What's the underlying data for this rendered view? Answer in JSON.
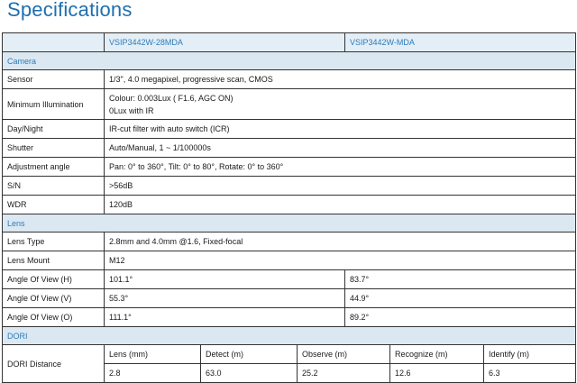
{
  "title": "Specifications",
  "models": [
    "VSIP3442W-28MDA",
    "VSIP3442W-MDA"
  ],
  "sections": {
    "camera": "Camera",
    "lens": "Lens",
    "dori": "DORI"
  },
  "camera": {
    "sensor": {
      "label": "Sensor",
      "value": "1/3\", 4.0 megapixel, progressive scan, CMOS"
    },
    "min_illum": {
      "label": "Minimum Illumination",
      "line1": "Colour: 0.003Lux ( F1.6, AGC ON)",
      "line2": "0Lux with IR"
    },
    "daynight": {
      "label": "Day/Night",
      "value": "IR-cut filter with auto switch (ICR)"
    },
    "shutter": {
      "label": "Shutter",
      "value": "Auto/Manual, 1 ~ 1/100000s"
    },
    "adjust": {
      "label": "Adjustment angle",
      "value": "Pan: 0° to 360°, Tilt: 0° to 80°, Rotate: 0° to 360°"
    },
    "sn": {
      "label": "S/N",
      "value": ">56dB"
    },
    "wdr": {
      "label": "WDR",
      "value": "120dB"
    }
  },
  "lens": {
    "type": {
      "label": "Lens Type",
      "value": "2.8mm and 4.0mm @1.6, Fixed-focal"
    },
    "mount": {
      "label": "Lens Mount",
      "value": "M12"
    },
    "aov_h": {
      "label": "Angle Of View (H)",
      "v1": "101.1°",
      "v2": "83.7°"
    },
    "aov_v": {
      "label": "Angle Of View (V)",
      "v1": "55.3°",
      "v2": "44.9°"
    },
    "aov_o": {
      "label": "Angle Of View (O)",
      "v1": "111.1°",
      "v2": "89.2°"
    }
  },
  "dori": {
    "label": "DORI Distance",
    "headers": [
      "Lens (mm)",
      "Detect (m)",
      "Observe (m)",
      "Recognize (m)",
      "Identify (m)"
    ],
    "values": [
      "2.8",
      "63.0",
      "25.2",
      "12.6",
      "6.3"
    ]
  }
}
